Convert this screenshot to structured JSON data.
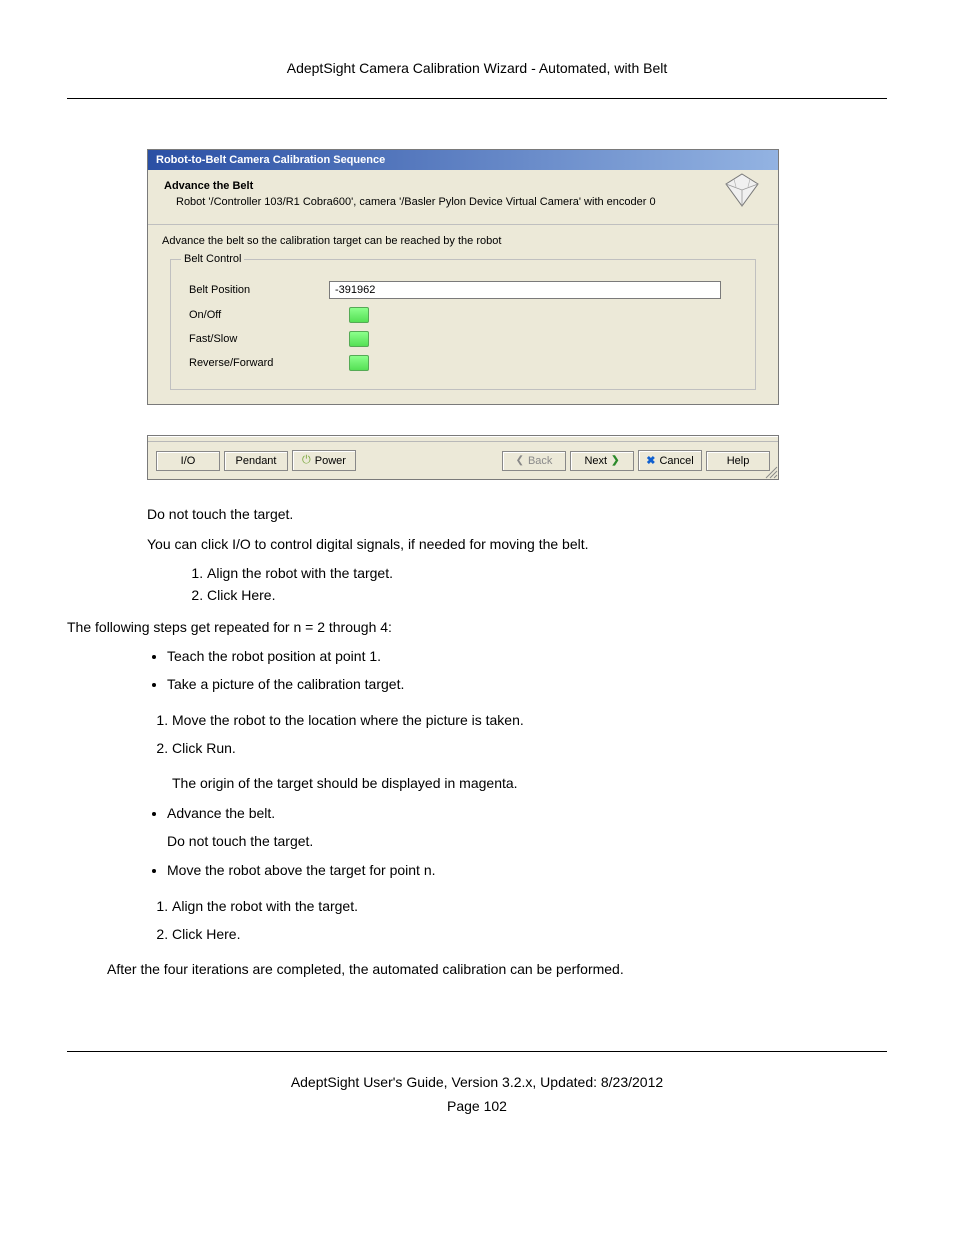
{
  "header": "AdeptSight Camera Calibration Wizard - Automated, with Belt",
  "dialog": {
    "title": "Robot-to-Belt Camera Calibration Sequence",
    "step_title": "Advance the Belt",
    "step_subtitle": "Robot '/Controller 103/R1 Cobra600', camera '/Basler Pylon Device Virtual Camera' with encoder 0",
    "instruction": "Advance the belt so the calibration target can be reached by the robot",
    "fieldset_legend": "Belt Control",
    "rows": {
      "belt_position_label": "Belt Position",
      "belt_position_value": "-391962",
      "onoff_label": "On/Off",
      "fastslow_label": "Fast/Slow",
      "revfwd_label": "Reverse/Forward"
    },
    "buttons": {
      "io": "I/O",
      "pendant": "Pendant",
      "power": "Power",
      "back": "Back",
      "next": "Next",
      "cancel": "Cancel",
      "help": "Help"
    }
  },
  "doc": {
    "p1": "Do not touch the target.",
    "p2": "You can click I/O to control digital signals, if needed for moving the belt.",
    "ol1_1": "Align the robot with the target.",
    "ol1_2": "Click Here.",
    "p3": "The following steps get repeated for n = 2 through 4:",
    "li1": "Teach the robot position at point 1.",
    "li2": "Take a picture of the calibration target.",
    "li2_ol1": "Move the robot to the location where the picture is taken.",
    "li2_ol2": "Click Run.",
    "li2_sub": "The origin of the target should be displayed in magenta.",
    "li3": "Advance the belt.",
    "li3_sub": "Do not touch the target.",
    "li4": "Move the robot above the target for point n.",
    "li4_ol1": "Align the robot with the target.",
    "li4_ol2": "Click Here.",
    "p4": "After the four iterations are completed, the automated calibration can be performed."
  },
  "footer": {
    "guide": "AdeptSight User's Guide,  Version 3.2.x, Updated: 8/23/2012",
    "page": "Page 102"
  }
}
